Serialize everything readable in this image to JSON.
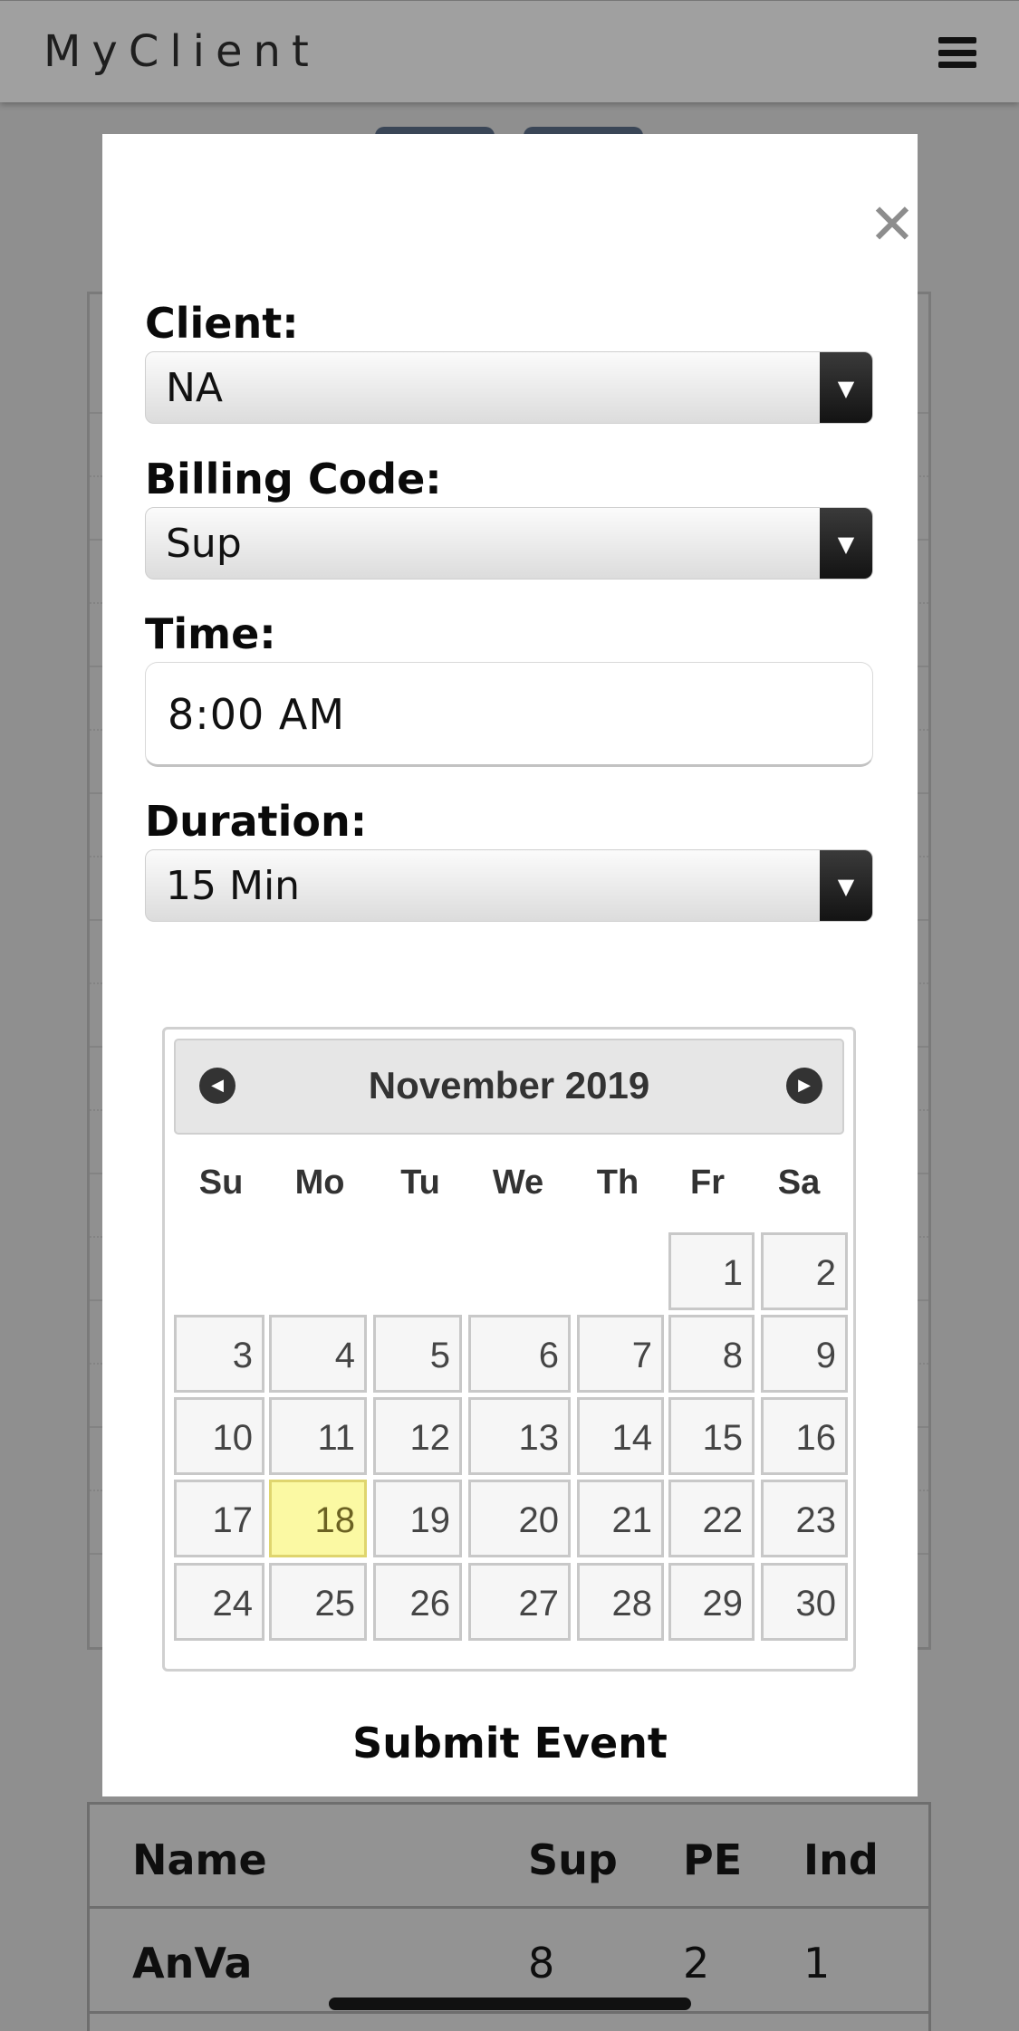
{
  "app": {
    "brand": "MyClient"
  },
  "modal": {
    "client_label": "Client:",
    "client_value": "NA",
    "billing_label": "Billing Code:",
    "billing_value": "Sup",
    "time_label": "Time:",
    "time_value": "8:00 AM",
    "duration_label": "Duration:",
    "duration_value": "15 Min",
    "submit_label": "Submit Event"
  },
  "calendar": {
    "title": "November 2019",
    "weekdays": [
      "Su",
      "Mo",
      "Tu",
      "We",
      "Th",
      "Fr",
      "Sa"
    ],
    "weeks": [
      [
        "",
        "",
        "",
        "",
        "",
        "1",
        "2"
      ],
      [
        "3",
        "4",
        "5",
        "6",
        "7",
        "8",
        "9"
      ],
      [
        "10",
        "11",
        "12",
        "13",
        "14",
        "15",
        "16"
      ],
      [
        "17",
        "18",
        "19",
        "20",
        "21",
        "22",
        "23"
      ],
      [
        "24",
        "25",
        "26",
        "27",
        "28",
        "29",
        "30"
      ]
    ],
    "selected_day": "18"
  },
  "table": {
    "headers": {
      "name": "Name",
      "sup": "Sup",
      "pe": "PE",
      "ind": "Ind"
    },
    "rows": [
      {
        "name": "AnVa",
        "sup": "8",
        "pe": "2",
        "ind": "1"
      }
    ]
  }
}
